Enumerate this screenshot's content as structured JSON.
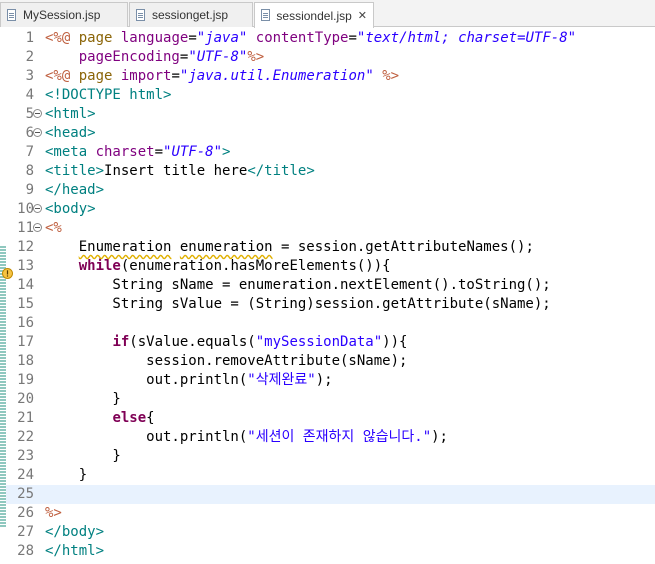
{
  "tabs": [
    {
      "label": "MySession.jsp",
      "active": false
    },
    {
      "label": "sessionget.jsp",
      "active": false
    },
    {
      "label": "sessiondel.jsp",
      "active": true
    }
  ],
  "tab_close_glyph": "✕",
  "editor": {
    "current_line": 25,
    "warning_line": 12,
    "lines": [
      {
        "n": "1",
        "fold": false,
        "tokens": [
          [
            "c-delim",
            "<%@ "
          ],
          [
            "c-tag",
            "page "
          ],
          [
            "c-attr",
            "language"
          ],
          [
            "c-txt",
            "="
          ],
          [
            "c-str",
            "\"java\""
          ],
          [
            "c-txt",
            " "
          ],
          [
            "c-attr",
            "contentType"
          ],
          [
            "c-txt",
            "="
          ],
          [
            "c-str",
            "\"text/html; charset=UTF-8\""
          ]
        ]
      },
      {
        "n": "2",
        "fold": false,
        "tokens": [
          [
            "c-txt",
            "    "
          ],
          [
            "c-attr",
            "pageEncoding"
          ],
          [
            "c-txt",
            "="
          ],
          [
            "c-str",
            "\"UTF-8\""
          ],
          [
            "c-delim",
            "%>"
          ]
        ]
      },
      {
        "n": "3",
        "fold": false,
        "tokens": [
          [
            "c-delim",
            "<%@ "
          ],
          [
            "c-tag",
            "page "
          ],
          [
            "c-attr",
            "import"
          ],
          [
            "c-txt",
            "="
          ],
          [
            "c-str",
            "\"java.util.Enumeration\""
          ],
          [
            "c-txt",
            " "
          ],
          [
            "c-delim",
            "%>"
          ]
        ]
      },
      {
        "n": "4",
        "fold": false,
        "tokens": [
          [
            "c-html",
            "<!DOCTYPE html>"
          ]
        ]
      },
      {
        "n": "5",
        "fold": true,
        "tokens": [
          [
            "c-html",
            "<html>"
          ]
        ]
      },
      {
        "n": "6",
        "fold": true,
        "tokens": [
          [
            "c-html",
            "<head>"
          ]
        ]
      },
      {
        "n": "7",
        "fold": false,
        "tokens": [
          [
            "c-html",
            "<meta "
          ],
          [
            "c-attr",
            "charset"
          ],
          [
            "c-txt",
            "="
          ],
          [
            "c-str",
            "\"UTF-8\""
          ],
          [
            "c-html",
            ">"
          ]
        ]
      },
      {
        "n": "8",
        "fold": false,
        "tokens": [
          [
            "c-html",
            "<title>"
          ],
          [
            "c-txt",
            "Insert title here"
          ],
          [
            "c-html",
            "</title>"
          ]
        ]
      },
      {
        "n": "9",
        "fold": false,
        "tokens": [
          [
            "c-html",
            "</head>"
          ]
        ]
      },
      {
        "n": "10",
        "fold": true,
        "tokens": [
          [
            "c-html",
            "<body>"
          ]
        ]
      },
      {
        "n": "11",
        "fold": true,
        "tokens": [
          [
            "c-delim",
            "<%"
          ]
        ]
      },
      {
        "n": "12",
        "fold": false,
        "tokens": [
          [
            "c-txt",
            "    "
          ],
          [
            "c-txt squig",
            "Enumeration"
          ],
          [
            "c-txt",
            " "
          ],
          [
            "c-txt squig",
            "enumeration"
          ],
          [
            "c-txt",
            " = session.getAttributeNames();"
          ]
        ]
      },
      {
        "n": "13",
        "fold": false,
        "tokens": [
          [
            "c-txt",
            "    "
          ],
          [
            "c-kw",
            "while"
          ],
          [
            "c-txt",
            "(enumeration.hasMoreElements()){"
          ]
        ]
      },
      {
        "n": "14",
        "fold": false,
        "tokens": [
          [
            "c-txt",
            "        String sName = enumeration.nextElement().toString();"
          ]
        ]
      },
      {
        "n": "15",
        "fold": false,
        "tokens": [
          [
            "c-txt",
            "        String sValue = (String)session.getAttribute(sName);"
          ]
        ]
      },
      {
        "n": "16",
        "fold": false,
        "tokens": []
      },
      {
        "n": "17",
        "fold": false,
        "tokens": [
          [
            "c-txt",
            "        "
          ],
          [
            "c-kw",
            "if"
          ],
          [
            "c-txt",
            "(sValue.equals("
          ],
          [
            "c-jstr",
            "\"mySessionData\""
          ],
          [
            "c-txt",
            ")){"
          ]
        ]
      },
      {
        "n": "18",
        "fold": false,
        "tokens": [
          [
            "c-txt",
            "            session.removeAttribute(sName);"
          ]
        ]
      },
      {
        "n": "19",
        "fold": false,
        "tokens": [
          [
            "c-txt",
            "            out.println("
          ],
          [
            "c-jstr",
            "\"삭제완료\""
          ],
          [
            "c-txt",
            ");"
          ]
        ]
      },
      {
        "n": "20",
        "fold": false,
        "tokens": [
          [
            "c-txt",
            "        }"
          ]
        ]
      },
      {
        "n": "21",
        "fold": false,
        "tokens": [
          [
            "c-txt",
            "        "
          ],
          [
            "c-kw",
            "else"
          ],
          [
            "c-txt",
            "{"
          ]
        ]
      },
      {
        "n": "22",
        "fold": false,
        "tokens": [
          [
            "c-txt",
            "            out.println("
          ],
          [
            "c-jstr",
            "\"세션이 존재하지 않습니다.\""
          ],
          [
            "c-txt",
            ");"
          ]
        ]
      },
      {
        "n": "23",
        "fold": false,
        "tokens": [
          [
            "c-txt",
            "        }"
          ]
        ]
      },
      {
        "n": "24",
        "fold": false,
        "tokens": [
          [
            "c-txt",
            "    }"
          ]
        ]
      },
      {
        "n": "25",
        "fold": false,
        "tokens": []
      },
      {
        "n": "26",
        "fold": false,
        "tokens": [
          [
            "c-delim",
            "%>"
          ]
        ]
      },
      {
        "n": "27",
        "fold": false,
        "tokens": [
          [
            "c-html",
            "</body>"
          ]
        ]
      },
      {
        "n": "28",
        "fold": false,
        "tokens": [
          [
            "c-html",
            "</html>"
          ]
        ]
      }
    ]
  },
  "icons": {
    "file": "jsp-file-icon",
    "warning": "warning-icon",
    "fold": "fold-collapse-icon"
  }
}
